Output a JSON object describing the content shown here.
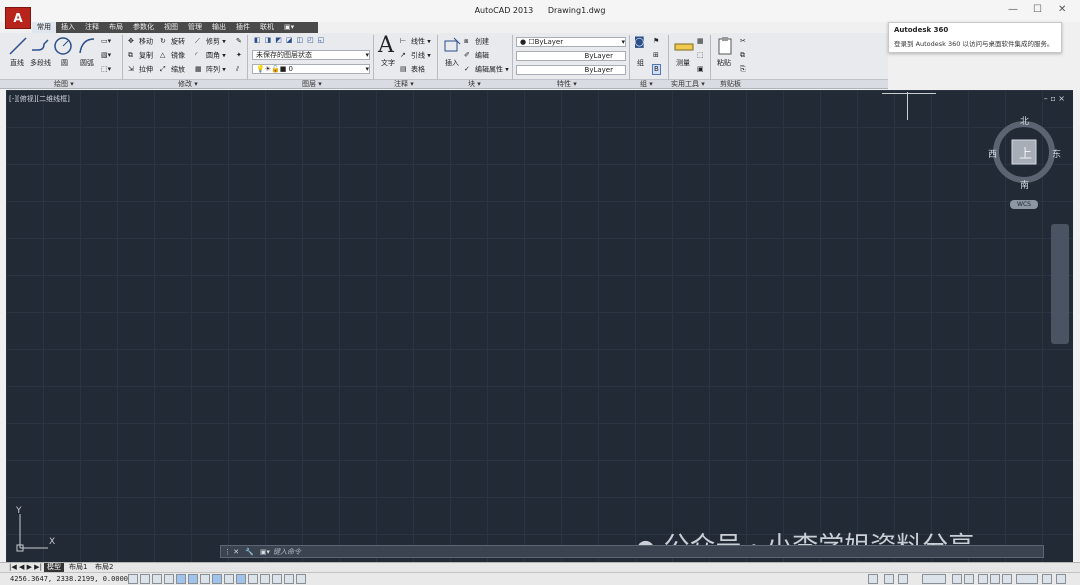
{
  "window": {
    "app_title": "AutoCAD 2013",
    "file_name": "Drawing1.dwg",
    "app_button_label": "A"
  },
  "ribbon_tabs": [
    "常用",
    "插入",
    "注释",
    "布局",
    "参数化",
    "视图",
    "管理",
    "输出",
    "插件",
    "联机"
  ],
  "ribbon": {
    "draw": {
      "line": "直线",
      "polyline": "多段线",
      "circle": "圆",
      "arc": "圆弧",
      "panel_title": "绘图 ▾"
    },
    "modify": {
      "move": "移动",
      "rotate": "旋转",
      "trim": "修剪",
      "copy": "复制",
      "mirror": "镜像",
      "fillet": "圆角",
      "stretch": "拉伸",
      "scale": "缩放",
      "array": "阵列",
      "panel_title": "修改 ▾"
    },
    "layers": {
      "saved_state": "未保存的图层状态",
      "current_layer": "0",
      "panel_title": "图层 ▾"
    },
    "annotation": {
      "text": "文字",
      "dimension": "线性",
      "leader": "引线",
      "table": "表格",
      "panel_title": "注释 ▾"
    },
    "block": {
      "insert": "插入",
      "create": "创建",
      "edit": "编辑",
      "edit_attr": "编辑属性",
      "panel_title": "块 ▾"
    },
    "properties": {
      "color": "ByLayer",
      "linetype": "ByLayer",
      "lineweight": "ByLayer",
      "panel_title": "特性 ▾"
    },
    "groups": {
      "group": "组",
      "panel_title": "组 ▾"
    },
    "utilities": {
      "measure": "测量",
      "panel_title": "实用工具 ▾"
    },
    "clipboard": {
      "paste": "粘贴",
      "panel_title": "剪贴板"
    }
  },
  "notification": {
    "title": "Autodesk 360",
    "body": "登录到 Autodesk 360 以访问与桌面软件集成的服务。"
  },
  "viewport": {
    "label": "[-][俯视][二维线框]",
    "controls": "– ▫ ×"
  },
  "viewcube": {
    "north": "北",
    "south": "南",
    "east": "东",
    "west": "西",
    "face": "上",
    "wcs": "WCS"
  },
  "ucs": {
    "x": "X",
    "y": "Y"
  },
  "command_line": {
    "placeholder": "键入命令"
  },
  "watermark": "公众号 · 小李学姐资料分享",
  "layout_tabs": [
    "模型",
    "布局1",
    "布局2"
  ],
  "status": {
    "coords": "4256.3647, 2338.2199, 0.0000"
  }
}
